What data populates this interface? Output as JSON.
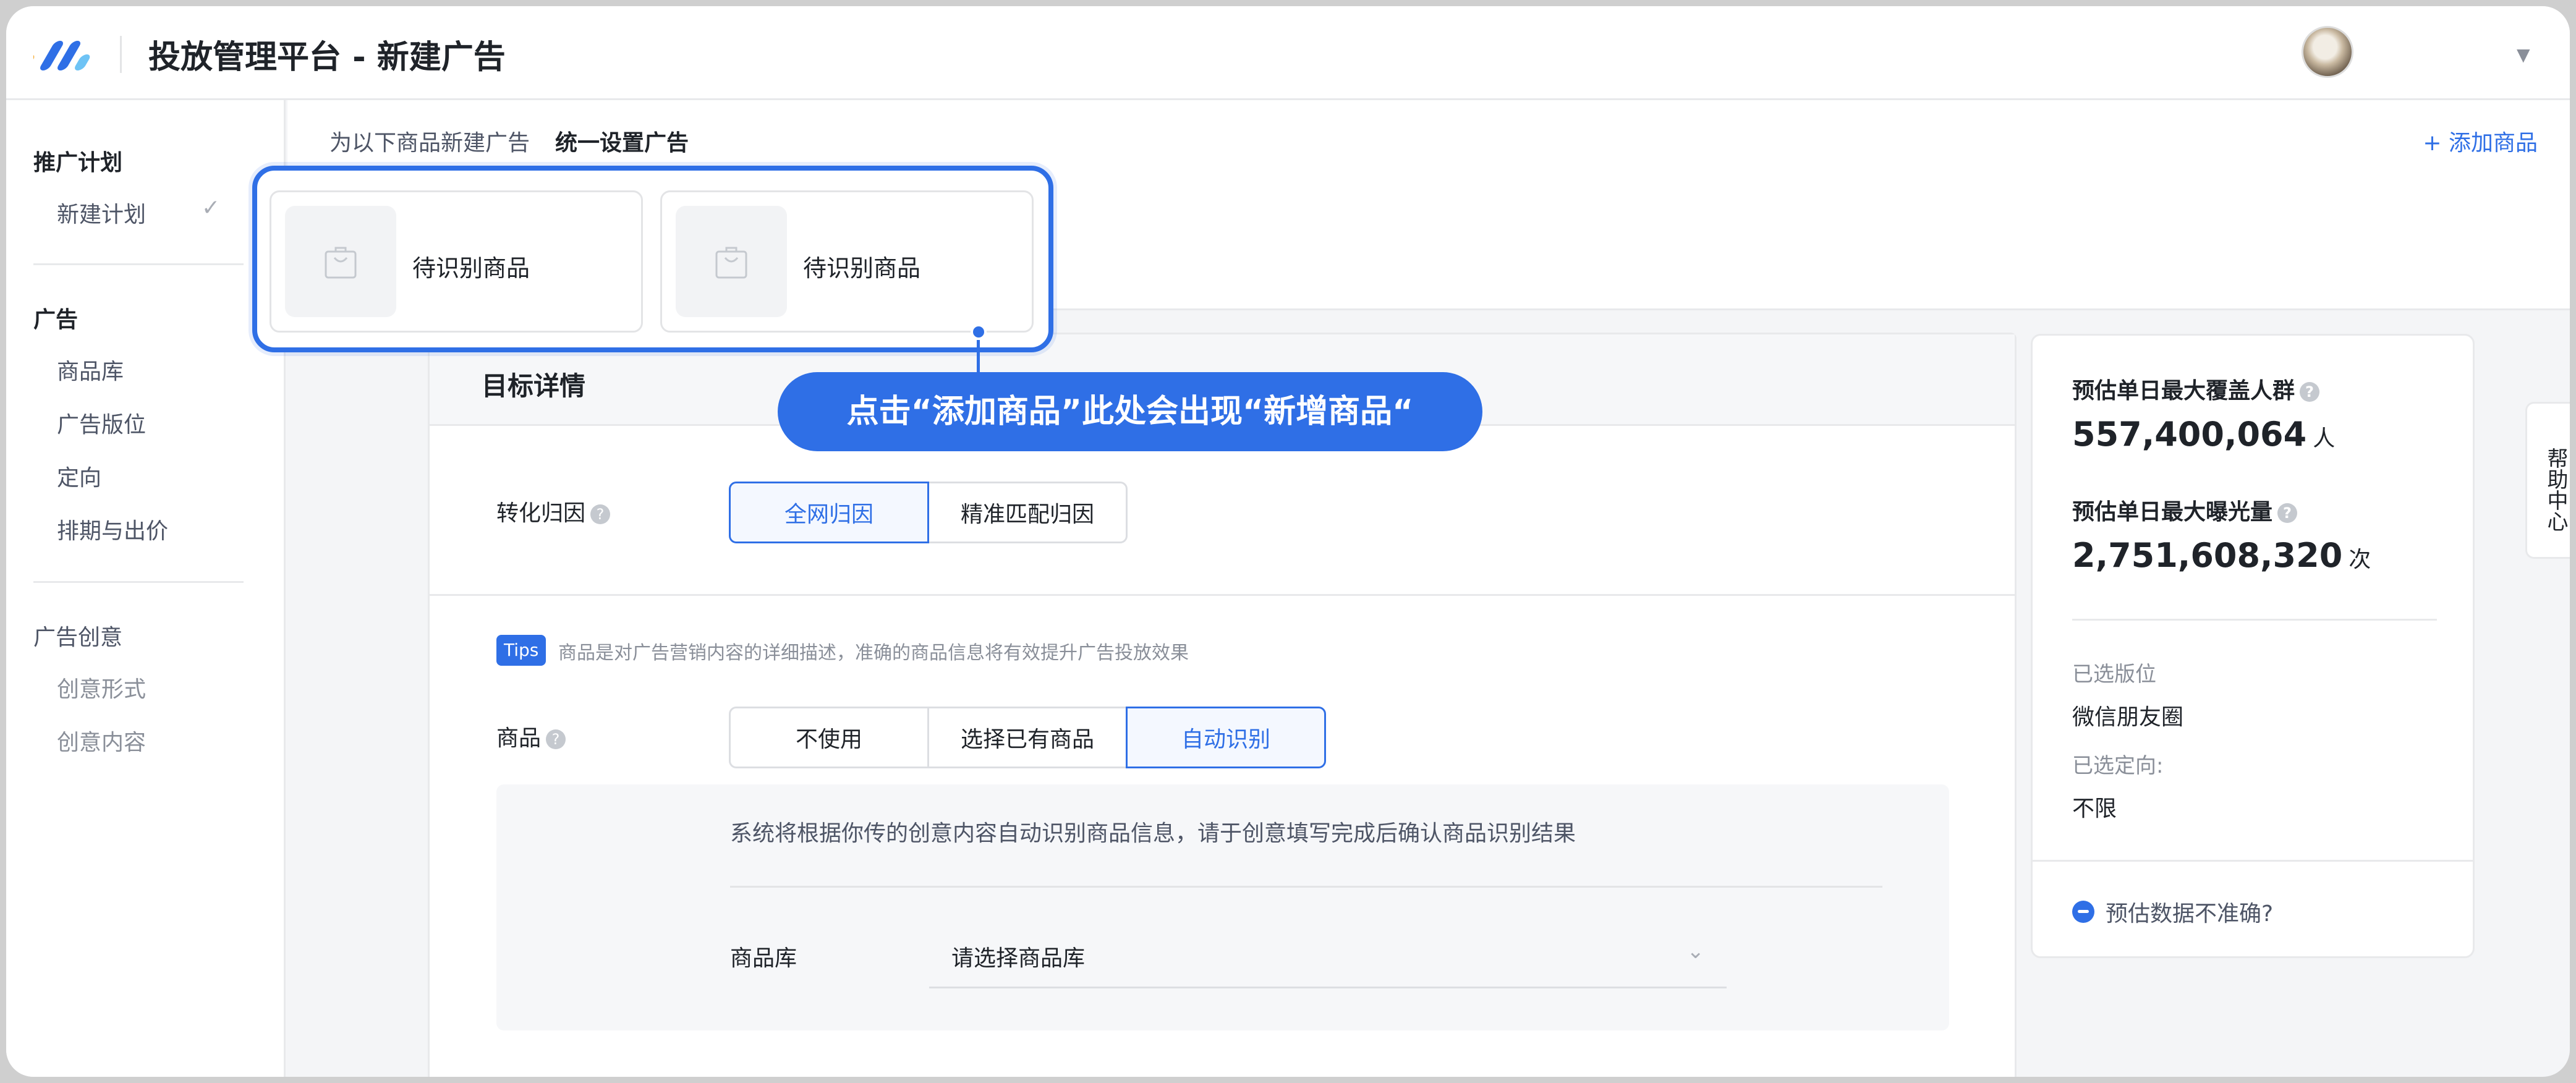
{
  "header": {
    "title": "投放管理平台 - 新建广告"
  },
  "sidebar": {
    "groups": [
      {
        "label": "推广计划",
        "items": [
          {
            "label": "新建计划",
            "done": true
          }
        ]
      },
      {
        "label": "广告",
        "items": [
          {
            "label": "商品库"
          },
          {
            "label": "广告版位"
          },
          {
            "label": "定向"
          },
          {
            "label": "排期与出价"
          }
        ]
      },
      {
        "label": "广告创意",
        "items": [
          {
            "label": "创意形式"
          },
          {
            "label": "创意内容"
          }
        ]
      }
    ]
  },
  "strip": {
    "label": "为以下商品新建广告",
    "unified_link": "统一设置广告",
    "add_product": "+ 添加商品",
    "products": [
      {
        "label": "待识别商品"
      },
      {
        "label": "待识别商品"
      }
    ]
  },
  "callout": "点击“添加商品”此处会出现“新增商品“",
  "main": {
    "title": "目标详情",
    "attribution": {
      "label": "转化归因",
      "options": [
        "全网归因",
        "精准匹配归因"
      ],
      "selected": "全网归因"
    },
    "tips": {
      "badge": "Tips",
      "text": "商品是对广告营销内容的详细描述，准确的商品信息将有效提升广告投放效果"
    },
    "product": {
      "label": "商品",
      "options": [
        "不使用",
        "选择已有商品",
        "自动识别"
      ],
      "selected": "自动识别"
    },
    "auto": {
      "description": "系统将根据你传的创意内容自动识别商品信息，请于创意填写完成后确认商品识别结果",
      "library_label": "商品库",
      "library_placeholder": "请选择商品库"
    }
  },
  "estimate": {
    "reach_label": "预估单日最大覆盖人群",
    "reach_value": "557,400,064",
    "reach_unit": "人",
    "impressions_label": "预估单日最大曝光量",
    "impressions_value": "2,751,608,320",
    "impressions_unit": "次",
    "placement_label": "已选版位",
    "placement_value": "微信朋友圈",
    "targeting_label": "已选定向:",
    "targeting_value": "不限",
    "feedback": "预估数据不准确?"
  },
  "help_tab": "帮助中心",
  "colors": {
    "accent": "#2f6fe6",
    "text": "#1f2329",
    "muted": "#8a8f99"
  }
}
